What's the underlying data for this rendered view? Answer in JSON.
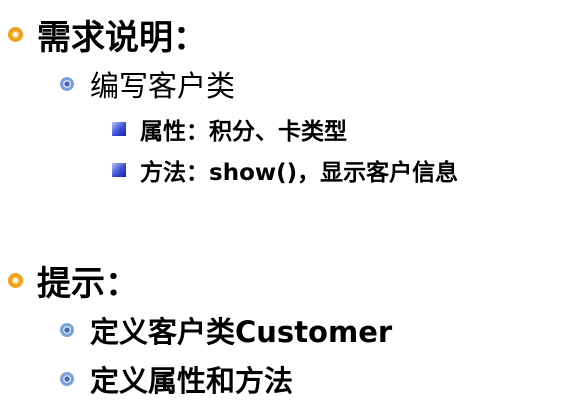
{
  "slide": {
    "section1": {
      "heading": "需求说明：",
      "item": "编写客户类",
      "subitems": [
        "属性：积分、卡类型",
        "方法：show()，显示客户信息"
      ]
    },
    "section2": {
      "heading": "提示：",
      "items": [
        "定义客户类Customer",
        "定义属性和方法"
      ]
    },
    "colors": {
      "level1_bullet": "#f0a21b",
      "level2_bullet": "#7da2d6",
      "level3_bullet": "#3a4fd8"
    },
    "bullet_icons": {
      "level1": "orange-ring-bullet-icon",
      "level2": "blue-ring-bullet-icon",
      "level3": "blue-square-bullet-icon"
    }
  }
}
